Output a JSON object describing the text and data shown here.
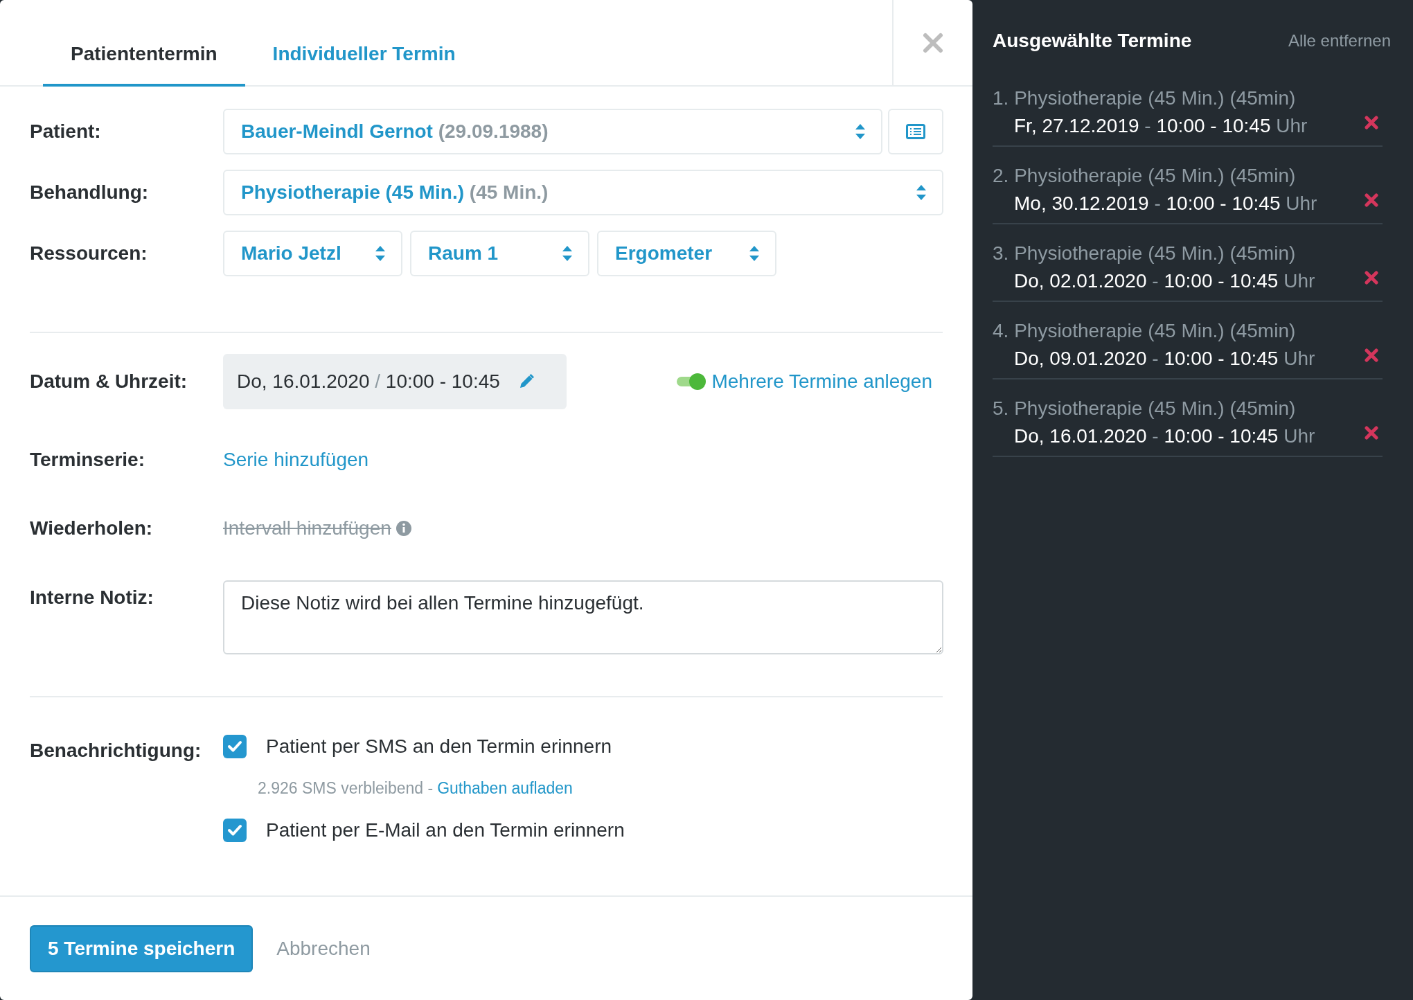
{
  "tabs": [
    {
      "label": "Patiententermin",
      "selected": true
    },
    {
      "label": "Individueller Termin",
      "selected": false
    }
  ],
  "form": {
    "patient": {
      "label": "Patient:",
      "value": "Bauer-Meindl Gernot",
      "detail": "(29.09.1988)"
    },
    "treatment": {
      "label": "Behandlung:",
      "value": "Physiotherapie (45 Min.)",
      "detail": "(45 Min.)"
    },
    "resources": {
      "label": "Ressourcen:",
      "items": [
        "Mario Jetzl",
        "Raum 1",
        "Ergometer"
      ]
    },
    "datetime": {
      "label": "Datum & Uhrzeit:",
      "date": "Do, 16.01.2020",
      "separator": "/",
      "time": "10:00 - 10:45"
    },
    "multiple": {
      "label": "Mehrere Termine anlegen",
      "on": true
    },
    "series": {
      "label": "Terminserie:",
      "link": "Serie hinzufügen"
    },
    "repeat": {
      "label": "Wiederholen:",
      "link": "Intervall hinzufügen",
      "disabled": true
    },
    "note": {
      "label": "Interne Notiz:",
      "value": "Diese Notiz wird bei allen Termine hinzugefügt."
    },
    "notification": {
      "label": "Benachrichtigung:",
      "options": [
        {
          "label": "Patient per SMS an den Termin erinnern",
          "checked": true
        },
        {
          "label": "Patient per E-Mail an den Termin erinnern",
          "checked": true
        }
      ],
      "sms_remaining": "2.926 SMS verbleibend",
      "sms_separator": "-",
      "topup_link": "Guthaben aufladen"
    }
  },
  "footer": {
    "save": "5 Termine speichern",
    "cancel": "Abbrechen"
  },
  "selected_panel": {
    "title": "Ausgewählte Termine",
    "clear": "Alle entfernen",
    "items": [
      {
        "number": "1.",
        "treatment": "Physiotherapie (45 Min.) (45min)",
        "date": "Fr, 27.12.2019",
        "separator": "-",
        "time": "10:00 - 10:45",
        "unit": "Uhr"
      },
      {
        "number": "2.",
        "treatment": "Physiotherapie (45 Min.) (45min)",
        "date": "Mo, 30.12.2019",
        "separator": "-",
        "time": "10:00 - 10:45",
        "unit": "Uhr"
      },
      {
        "number": "3.",
        "treatment": "Physiotherapie (45 Min.) (45min)",
        "date": "Do, 02.01.2020",
        "separator": "-",
        "time": "10:00 - 10:45",
        "unit": "Uhr"
      },
      {
        "number": "4.",
        "treatment": "Physiotherapie (45 Min.) (45min)",
        "date": "Do, 09.01.2020",
        "separator": "-",
        "time": "10:00 - 10:45",
        "unit": "Uhr"
      },
      {
        "number": "5.",
        "treatment": "Physiotherapie (45 Min.) (45min)",
        "date": "Do, 16.01.2020",
        "separator": "-",
        "time": "10:00 - 10:45",
        "unit": "Uhr"
      }
    ]
  }
}
